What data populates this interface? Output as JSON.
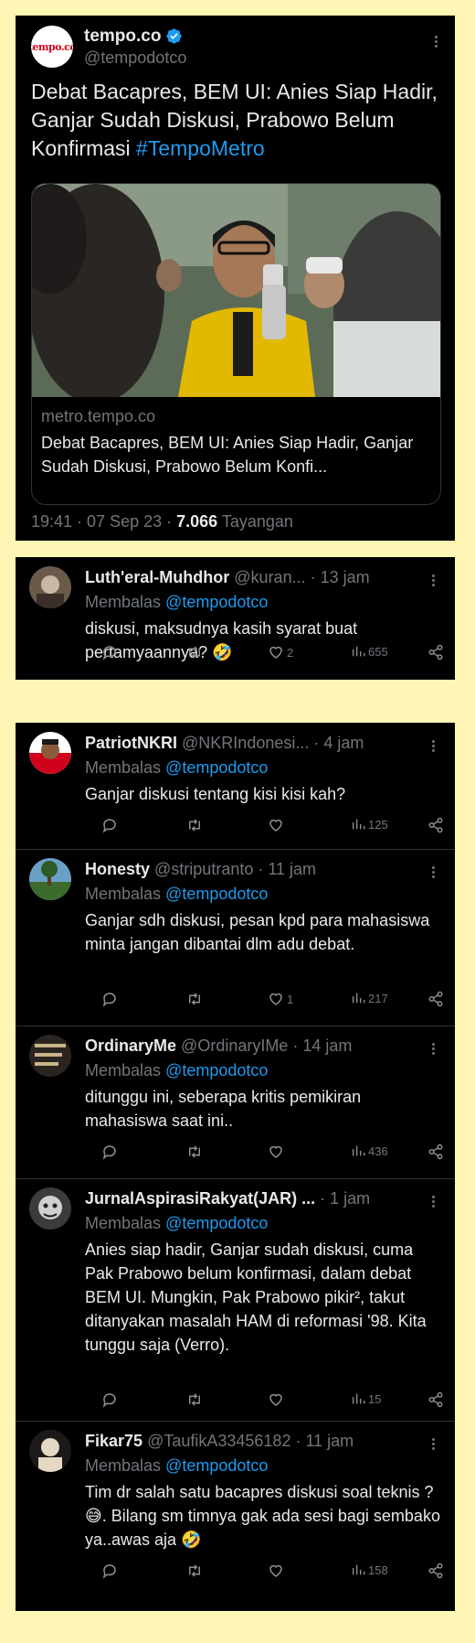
{
  "main": {
    "name": "tempo.co",
    "handle": "@tempodotco",
    "logo_text": "tempo.co",
    "text": "Debat Bacapres, BEM UI: Anies Siap Hadir, Ganjar Sudah Diskusi, Prabowo Belum Konfirmasi",
    "hashtag": "#TempoMetro",
    "link_domain": "metro.tempo.co",
    "link_title": "Debat Bacapres, BEM UI: Anies Siap Hadir, Ganjar Sudah Diskusi, Prabowo Belum Konfi...",
    "time": "19:41 · 07 Sep 23 · ",
    "views": "7.066",
    "views_label": " Tayangan"
  },
  "replies_label": "Membalas",
  "replies_target": "@tempodotco",
  "first": {
    "name": "Luth'eral-Muhdhor",
    "handle": "@kuran...",
    "time": " · 13 jam",
    "text": "diskusi, maksudnya kasih syarat buat pertamyaannya? 🤣",
    "likes": "2",
    "views": "655"
  },
  "thread": [
    {
      "name": "PatriotNKRI",
      "handle": "@NKRIndonesi...",
      "time": " · 4 jam",
      "text": "Ganjar diskusi tentang kisi kisi kah?",
      "likes": "",
      "views": "125"
    },
    {
      "name": "Honesty",
      "handle": "@striputranto",
      "time": " · 11 jam",
      "text": "Ganjar sdh diskusi, pesan kpd para mahasiswa minta jangan dibantai dlm adu debat.",
      "likes": "1",
      "views": "217"
    },
    {
      "name": "OrdinaryMe",
      "handle": "@OrdinaryIMe",
      "time": " · 14 jam",
      "text": "ditunggu ini, seberapa kritis pemikiran mahasiswa saat ini..",
      "likes": "",
      "views": "436"
    },
    {
      "name": "JurnalAspirasiRakyat(JAR) ...",
      "handle": "",
      "time": " · 1 jam",
      "text": "Anies siap hadir, Ganjar sudah diskusi, cuma Pak Prabowo belum konfirmasi, dalam debat BEM UI. Mungkin, Pak Prabowo pikir², takut ditanyakan masalah HAM di reformasi '98. Kita tunggu saja (Verro).",
      "likes": "",
      "views": "15"
    },
    {
      "name": "Fikar75",
      "handle": "@TaufikA33456182",
      "time": " · 11 jam",
      "text": "Tim dr salah satu bacapres diskusi soal teknis ? 😅. Bilang sm timnya gak ada sesi bagi sembako ya..awas aja 🤣",
      "likes": "",
      "views": "158"
    }
  ],
  "colors": {
    "background": "#fef6b4",
    "card": "#000000",
    "link": "#1d9bf0",
    "muted": "#71767b",
    "text": "#e7e9ea"
  }
}
